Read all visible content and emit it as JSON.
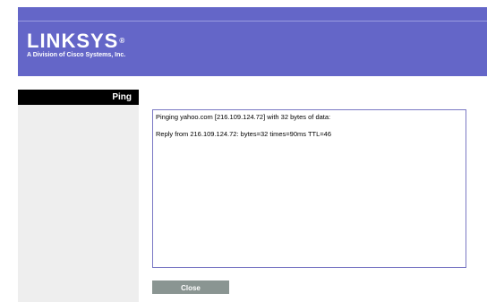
{
  "header": {
    "logo_name": "LINKSYS",
    "logo_reg": "®",
    "logo_tagline": "A Division of Cisco Systems, Inc."
  },
  "sidebar": {
    "section_label": "Ping"
  },
  "output": {
    "lines": [
      "Pinging yahoo.com [216.109.124.72] with 32 bytes of data:",
      "Reply from 216.109.124.72: bytes=32 times=90ms TTL=46"
    ]
  },
  "actions": {
    "close_label": "Close"
  },
  "colors": {
    "header_bg": "#6466c8",
    "section_label_bg": "#000000",
    "sidebar_bg": "#eeeeee",
    "output_border": "#7a78c4",
    "close_button_bg": "#8a9592"
  }
}
